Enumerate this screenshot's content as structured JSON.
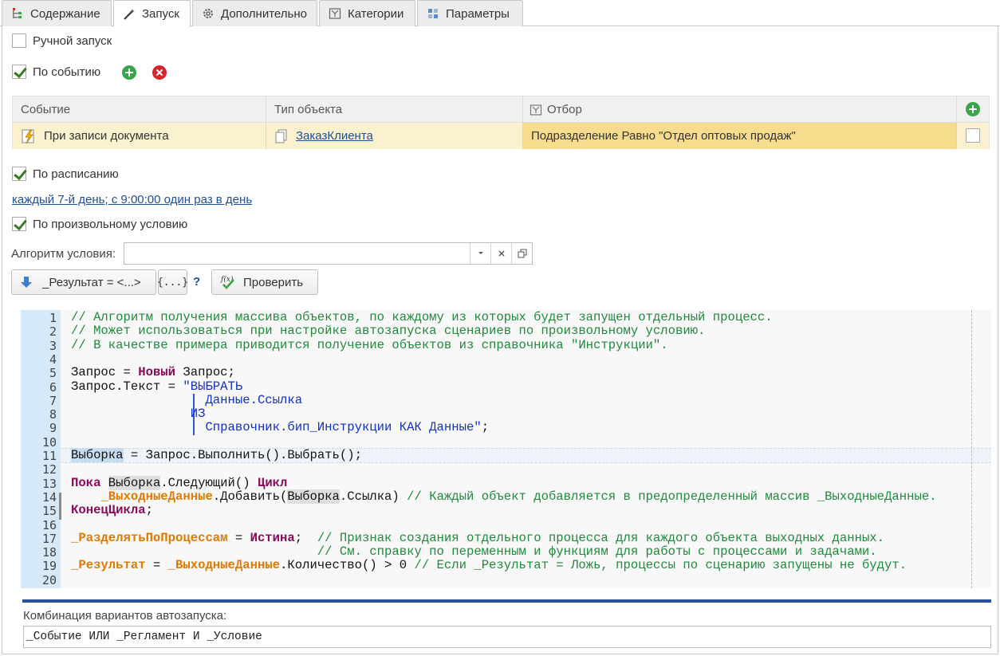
{
  "tabs": [
    {
      "label": "Содержание",
      "icon": "tree-icon"
    },
    {
      "label": "Запуск",
      "icon": "magic-wand-icon"
    },
    {
      "label": "Дополнительно",
      "icon": "gear-icon"
    },
    {
      "label": "Категории",
      "icon": "folder-icon"
    },
    {
      "label": "Параметры",
      "icon": "grid-icon"
    }
  ],
  "launch": {
    "manual_label": "Ручной запуск",
    "manual_checked": false,
    "event_label": "По событию",
    "event_checked": true,
    "schedule_label": "По расписанию",
    "schedule_checked": true,
    "schedule_link": "каждый 7-й день; с 9:00:00 один раз в день",
    "custom_label": "По произвольному условию",
    "custom_checked": true
  },
  "events_table": {
    "columns": [
      "Событие",
      "Тип объекта",
      "Отбор"
    ],
    "rows": [
      {
        "event": "При записи документа",
        "object_type": "ЗаказКлиента",
        "filter": "Подразделение Равно \"Отдел оптовых продаж\"",
        "checked": false
      }
    ]
  },
  "condition": {
    "algorithm_label": "Алгоритм условия:",
    "algorithm_value": "",
    "result_button": "_Результат = <...>",
    "braces_button": "{...}",
    "help_label": "?",
    "check_button": "Проверить"
  },
  "code": {
    "line_numbers": [
      "1",
      "2",
      "3",
      "4",
      "5",
      "6",
      "7",
      "8",
      "9",
      "10",
      "11",
      "12",
      "13",
      "14",
      "15",
      "16",
      "17",
      "18",
      "19",
      "20"
    ],
    "lines": [
      "// Алгоритм получения массива объектов, по каждому из которых будет запущен отдельный процесс.",
      "// Может использоваться при настройке автозапуска сценариев по произвольному условию.",
      "// В качестве примера приводится получение объектов из справочника \"Инструкции\".",
      "",
      "Запрос = Новый Запрос;",
      "Запрос.Текст = \"ВЫБРАТЬ",
      "                  Данные.Ссылка",
      "                ИЗ",
      "                  Справочник.бип_Инструкции КАК Данные\";",
      "",
      "Выборка = Запрос.Выполнить().Выбрать();",
      "",
      "Пока Выборка.Следующий() Цикл",
      "    _ВыходныеДанные.Добавить(Выборка.Ссылка) // Каждый объект добавляется в предопределенный массив _ВыходныеДанные.",
      "КонецЦикла;",
      "",
      "_РазделятьПоПроцессам = Истина;  // Признак создания отдельного процесса для каждого объекта выходных данных.",
      "                                 // См. справку по переменным и функциям для работы с процессами и задачами.",
      "_Результат = _ВыходныеДанные.Количество() > 0 // Если _Результат = Ложь, процессы по сценарию запущены не будут.",
      ""
    ]
  },
  "combination": {
    "label": "Комбинация вариантов автозапуска:",
    "value": "_Событие ИЛИ _Регламент И _Условие"
  }
}
